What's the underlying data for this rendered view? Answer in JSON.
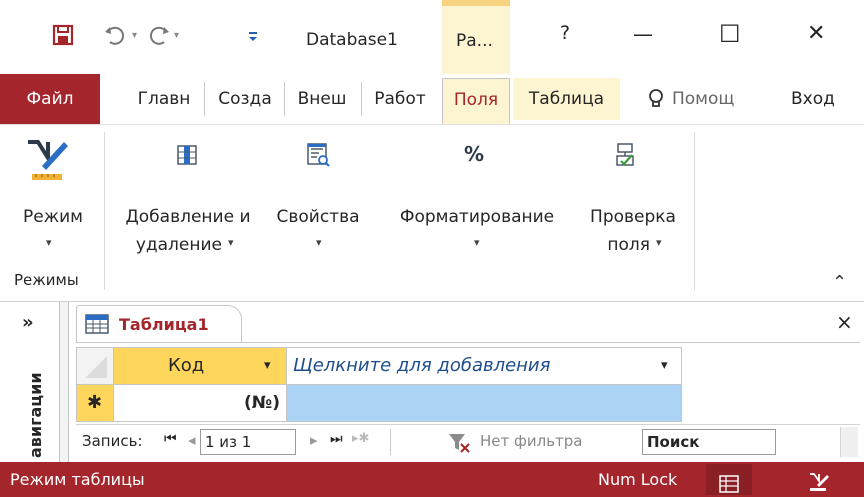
{
  "window": {
    "title": "Database1",
    "context_tab": "Ра...",
    "help": "?",
    "minimize": "—",
    "maximize": "☐",
    "close": "✕"
  },
  "qat": {
    "save_icon": "save-icon",
    "undo_icon": "undo-icon",
    "redo_icon": "redo-icon",
    "customize_icon": "customize-qat-icon"
  },
  "menu": {
    "file": "Файл",
    "tabs": [
      "Главн",
      "Созда",
      "Внеш",
      "Работ",
      "Поля",
      "Таблица"
    ],
    "tell_me": "Помощь",
    "signin": "Вход"
  },
  "ribbon": {
    "groups": [
      {
        "label": "Режим",
        "caret": "▾",
        "icon": "view-mode-icon"
      },
      {
        "label": "Добавление и",
        "label2": "удаление",
        "caret": "▾",
        "icon": "add-delete-icon"
      },
      {
        "label": "Свойства",
        "caret": "▾",
        "icon": "properties-icon"
      },
      {
        "label": "Форматирование",
        "caret": "▾",
        "icon": "formatting-icon",
        "icon_text": "%"
      },
      {
        "label": "Проверка",
        "label2": "поля",
        "caret": "▾",
        "icon": "field-validation-icon"
      }
    ],
    "group_name": "Режимы",
    "collapse": "⌃"
  },
  "nav": {
    "toggle": "»",
    "label": "авигации"
  },
  "document": {
    "tab_label": "Таблица1",
    "close": "×",
    "grid": {
      "column1": "Код",
      "column2": "Щелкните для добавления",
      "new_row_marker": "✱",
      "new_row_value": "(№)"
    },
    "record_nav": {
      "label": "Запись:",
      "first": "⏮",
      "prev": "◂",
      "current": "1 из 1",
      "next": "▸",
      "last": "⏭",
      "new": "▸✱",
      "filter": "Нет фильтра",
      "search_placeholder": "Поиск"
    }
  },
  "status": {
    "mode": "Режим таблицы",
    "numlock": "Num Lock",
    "view1_icon": "datasheet-view-icon",
    "view2_icon": "design-view-icon"
  },
  "colors": {
    "accent": "#a4262c",
    "context": "#fdf4d2",
    "header_yellow": "#ffd65c",
    "selection_blue": "#aad3f5"
  }
}
